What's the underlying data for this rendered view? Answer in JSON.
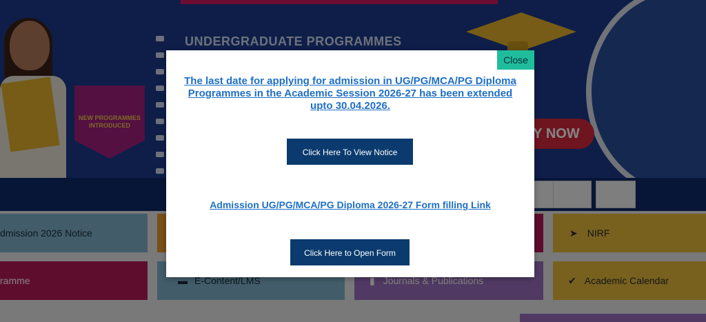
{
  "hero": {
    "heading": "UNDERGRADUATE PROGRAMMES",
    "badge_text": "NEW PROGRAMMES INTRODUCED",
    "apply_text": "Y NOW"
  },
  "tiles": [
    {
      "label": "dmission 2026 Notice",
      "color": "#7fb3c9",
      "icon": ""
    },
    {
      "label": "NIRF",
      "color": "#e6b93d",
      "icon": "paper-plane-icon",
      "glyph": "➤"
    },
    {
      "label": "ramme",
      "color": "#b51a55",
      "icon": ""
    },
    {
      "label": "E-Content/LMS",
      "color": "#7fb3c9",
      "icon": "laptop-icon",
      "glyph": "▬"
    },
    {
      "label": "Journals & Publications",
      "color": "#9a6fbf",
      "icon": "book-icon",
      "glyph": "▮"
    },
    {
      "label": "Academic Calendar",
      "color": "#e6b93d",
      "icon": "check-circle-icon",
      "glyph": "✔"
    }
  ],
  "modal": {
    "close_label": "Close",
    "notice_text": "The last date for applying for admission in UG/PG/MCA/PG Diploma Programmes in the Academic Session 2026-27 has been extended upto 30.04.2026.",
    "notice_button": "Click Here To View Notice",
    "form_link": "Admission UG/PG/MCA/PG Diploma 2026-27 Form filling Link",
    "form_button": "Click Here to Open Form"
  },
  "colors": {
    "accent_close": "#1fbd9c",
    "button_bg": "#0b3b6e",
    "link": "#1e6fc4"
  }
}
